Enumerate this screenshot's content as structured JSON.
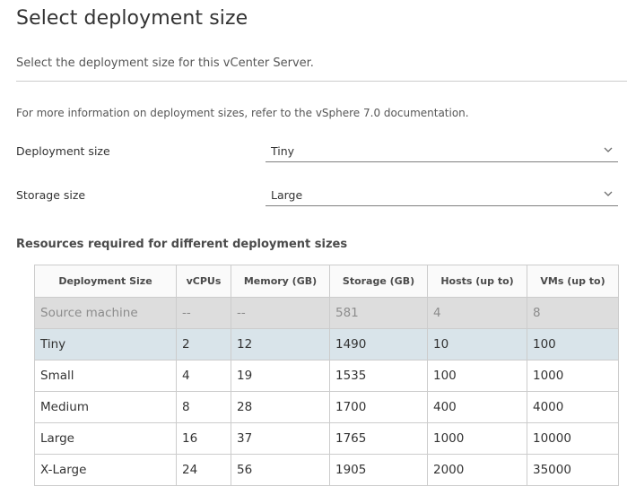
{
  "header": {
    "title": "Select deployment size",
    "subtitle": "Select the deployment size for this vCenter Server."
  },
  "info_text": "For more information on deployment sizes, refer to the vSphere 7.0 documentation.",
  "form": {
    "deployment_size": {
      "label": "Deployment size",
      "value": "Tiny",
      "icon": "chevron-down-icon"
    },
    "storage_size": {
      "label": "Storage size",
      "value": "Large",
      "icon": "chevron-down-icon"
    }
  },
  "resources": {
    "title": "Resources required for different deployment sizes",
    "columns": [
      "Deployment Size",
      "vCPUs",
      "Memory (GB)",
      "Storage (GB)",
      "Hosts (up to)",
      "VMs (up to)"
    ],
    "rows": [
      {
        "cells": [
          "Source machine",
          "--",
          "--",
          "581",
          "4",
          "8"
        ],
        "state": "source"
      },
      {
        "cells": [
          "Tiny",
          "2",
          "12",
          "1490",
          "10",
          "100"
        ],
        "state": "selected"
      },
      {
        "cells": [
          "Small",
          "4",
          "19",
          "1535",
          "100",
          "1000"
        ],
        "state": ""
      },
      {
        "cells": [
          "Medium",
          "8",
          "28",
          "1700",
          "400",
          "4000"
        ],
        "state": ""
      },
      {
        "cells": [
          "Large",
          "16",
          "37",
          "1765",
          "1000",
          "10000"
        ],
        "state": ""
      },
      {
        "cells": [
          "X-Large",
          "24",
          "56",
          "1905",
          "2000",
          "35000"
        ],
        "state": ""
      }
    ]
  },
  "colors": {
    "selected_row": "#d9e4ea",
    "source_row": "#dddddd",
    "source_text": "#8c8c8c",
    "border": "#cccccc"
  }
}
